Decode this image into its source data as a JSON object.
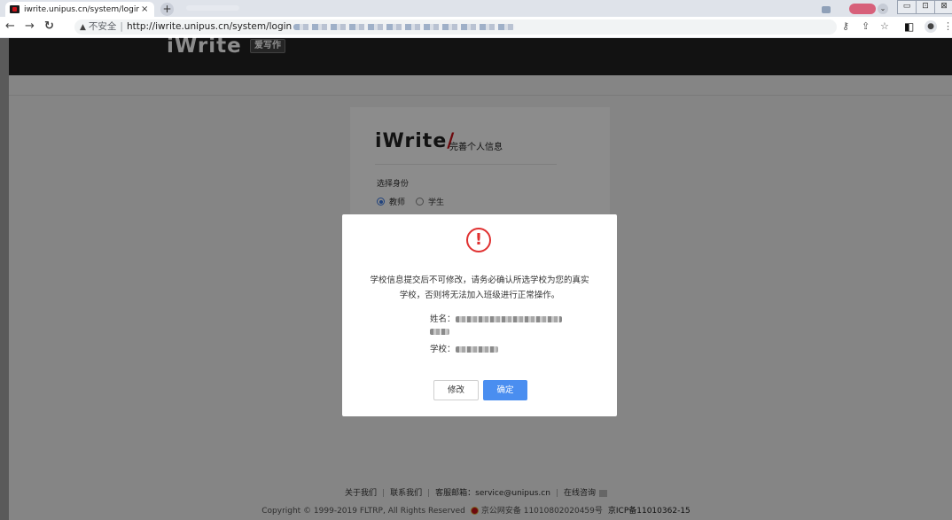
{
  "browser": {
    "tab_title": "iwrite.unipus.cn/system/login",
    "tab_close": "×",
    "new_tab": "+",
    "insecure_label": "不安全",
    "separator": "|",
    "url": "http://iwrite.unipus.cn/system/login",
    "window_controls": [
      "▭",
      "⊡",
      "⊠"
    ]
  },
  "header": {
    "logo": "iWrite",
    "badge": "爱写作"
  },
  "card": {
    "logo": "iWrite",
    "subtitle": "完善个人信息",
    "identity_label": "选择身份",
    "roles": [
      {
        "label": "教师",
        "selected": true
      },
      {
        "label": "学生",
        "selected": false
      }
    ]
  },
  "modal": {
    "icon": "!",
    "message_line1": "学校信息提交后不可修改，请务必确认所选学校为您的真实",
    "message_line2": "学校，否则将无法加入班级进行正常操作。",
    "name_label": "姓名：",
    "school_label": "学校：",
    "modify_button": "修改",
    "confirm_button": "确定"
  },
  "footer": {
    "links": [
      "关于我们",
      "联系我们",
      "客服邮箱：service@unipus.cn",
      "在线咨询"
    ],
    "copyright": "Copyright © 1999-2019 FLTRP, All Rights Reserved",
    "police_record": "京公网安备 11010802020459号",
    "icp": "京ICP备11010362-15"
  },
  "colors": {
    "header_bg": "#222222",
    "accent_red": "#c8131a",
    "confirm_blue": "#4a8ef0",
    "alert_red": "#e03131"
  }
}
